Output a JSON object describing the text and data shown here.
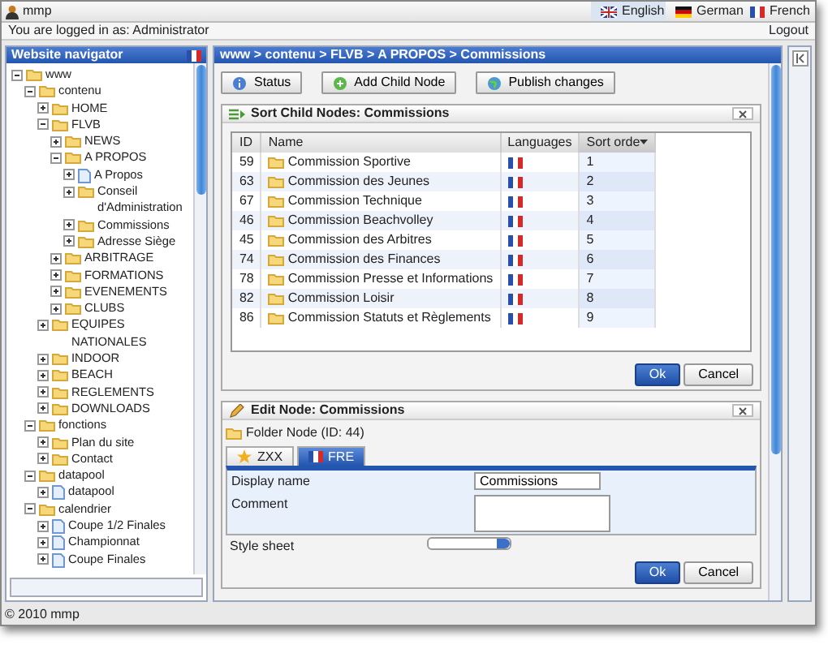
{
  "app": {
    "name": "mmp"
  },
  "languages": [
    {
      "label": "English",
      "kind": "en",
      "selected": true
    },
    {
      "label": "German",
      "kind": "de",
      "selected": false
    },
    {
      "label": "French",
      "kind": "fr",
      "selected": false
    }
  ],
  "login_text": "You are logged in as: Administrator",
  "logout": "Logout",
  "navigator": {
    "title": "Website navigator",
    "tree": [
      {
        "label": "www",
        "kind": "folder",
        "expanded": true,
        "children": [
          {
            "label": "contenu",
            "kind": "folder",
            "expanded": true,
            "children": [
              {
                "label": "HOME",
                "kind": "folder",
                "expanded": false
              },
              {
                "label": "FLVB",
                "kind": "folder",
                "expanded": true,
                "children": [
                  {
                    "label": "NEWS",
                    "kind": "folder",
                    "expanded": false
                  },
                  {
                    "label": "A PROPOS",
                    "kind": "folder",
                    "expanded": true,
                    "children": [
                      {
                        "label": "A Propos",
                        "kind": "page",
                        "expanded": false
                      },
                      {
                        "label": "Conseil d'Administration",
                        "kind": "folder",
                        "expanded": false
                      },
                      {
                        "label": "Commissions",
                        "kind": "folder",
                        "expanded": false
                      },
                      {
                        "label": "Adresse Siège",
                        "kind": "folder",
                        "expanded": false
                      }
                    ]
                  },
                  {
                    "label": "ARBITRAGE",
                    "kind": "folder",
                    "expanded": false
                  },
                  {
                    "label": "FORMATIONS",
                    "kind": "folder",
                    "expanded": false
                  },
                  {
                    "label": "EVENEMENTS",
                    "kind": "folder",
                    "expanded": false
                  },
                  {
                    "label": "CLUBS",
                    "kind": "folder",
                    "expanded": false
                  }
                ]
              },
              {
                "label": "EQUIPES NATIONALES",
                "kind": "folder",
                "expanded": false
              },
              {
                "label": "INDOOR",
                "kind": "folder",
                "expanded": false
              },
              {
                "label": "BEACH",
                "kind": "folder",
                "expanded": false
              },
              {
                "label": "REGLEMENTS",
                "kind": "folder",
                "expanded": false
              },
              {
                "label": "DOWNLOADS",
                "kind": "folder",
                "expanded": false
              }
            ]
          },
          {
            "label": "fonctions",
            "kind": "folder",
            "expanded": true,
            "children": [
              {
                "label": "Plan du site",
                "kind": "folder",
                "expanded": false
              },
              {
                "label": "Contact",
                "kind": "folder",
                "expanded": false
              }
            ]
          },
          {
            "label": "datapool",
            "kind": "folder",
            "expanded": true,
            "children": [
              {
                "label": "datapool",
                "kind": "page",
                "expanded": false
              }
            ]
          },
          {
            "label": "calendrier",
            "kind": "folder",
            "expanded": true,
            "children": [
              {
                "label": "Coupe 1/2 Finales",
                "kind": "page",
                "expanded": false
              },
              {
                "label": "Championnat",
                "kind": "page",
                "expanded": false
              },
              {
                "label": "Coupe Finales",
                "kind": "page",
                "expanded": false
              }
            ]
          }
        ]
      }
    ]
  },
  "breadcrumb": "www > contenu > FLVB > A PROPOS > Commissions",
  "toolbar": [
    {
      "label": "Status",
      "kind": "info"
    },
    {
      "label": "Add Child Node",
      "kind": "add"
    },
    {
      "label": "Publish changes",
      "kind": "globe"
    }
  ],
  "sort_panel": {
    "title": "Sort Child Nodes: Commissions",
    "columns": [
      {
        "label": "ID",
        "sorted": false
      },
      {
        "label": "Name",
        "sorted": false
      },
      {
        "label": "Languages",
        "sorted": false
      },
      {
        "label": "Sort orde",
        "sorted": true
      }
    ],
    "rows": [
      {
        "id": "59",
        "name": "Commission Sportive",
        "sort": "1"
      },
      {
        "id": "63",
        "name": "Commission des Jeunes",
        "sort": "2"
      },
      {
        "id": "67",
        "name": "Commission Technique",
        "sort": "3"
      },
      {
        "id": "46",
        "name": "Commission Beachvolley",
        "sort": "4"
      },
      {
        "id": "45",
        "name": "Commission des Arbitres",
        "sort": "5"
      },
      {
        "id": "74",
        "name": "Commission des Finances",
        "sort": "6"
      },
      {
        "id": "78",
        "name": "Commission Presse et Informations",
        "sort": "7"
      },
      {
        "id": "82",
        "name": "Commission Loisir",
        "sort": "8"
      },
      {
        "id": "86",
        "name": "Commission Statuts et Règlements",
        "sort": "9"
      }
    ],
    "buttons": [
      {
        "label": "Ok",
        "primary": true
      },
      {
        "label": "Cancel",
        "primary": false
      }
    ]
  },
  "edit_panel": {
    "title": "Edit Node: Commissions",
    "node_info": "Folder Node (ID: 44)",
    "tabs": [
      {
        "label": "ZXX",
        "kind": "star",
        "selected": false
      },
      {
        "label": "FRE",
        "kind": "flag",
        "selected": true
      }
    ],
    "fields": [
      {
        "label": "Display name",
        "kind": "text",
        "value": "Commissions"
      },
      {
        "label": "Comment",
        "kind": "textarea"
      },
      {
        "label": "Style sheet",
        "kind": "select"
      }
    ],
    "buttons": [
      {
        "label": "Ok",
        "primary": true
      },
      {
        "label": "Cancel",
        "primary": false
      }
    ]
  },
  "footer": "© 2010 mmp"
}
